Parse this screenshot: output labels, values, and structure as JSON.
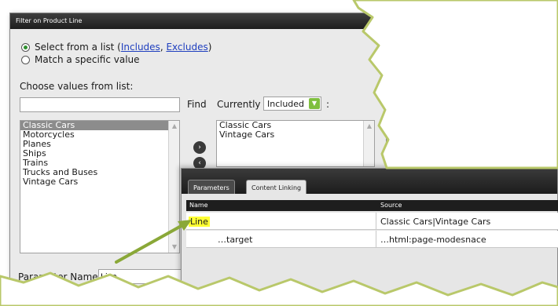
{
  "dialog": {
    "title": "Filter on Product Line",
    "radio_list_label": "Select from a list (",
    "includes_link": "Includes",
    "separator": ", ",
    "excludes_link": "Excludes",
    "closing_paren": ")",
    "radio_match_label": "Match a specific value",
    "choose_label": "Choose values from list:",
    "search_value": "",
    "find_label": "Find",
    "currently_label": "Currently",
    "currently_value": "Included",
    "colon": ":",
    "available_values": [
      "Classic Cars",
      "Motorcycles",
      "Planes",
      "Ships",
      "Trains",
      "Trucks and Buses",
      "Vintage Cars"
    ],
    "selected_index": 0,
    "chosen_values": [
      "Classic Cars",
      "Vintage Cars"
    ],
    "param_name_label": "Parameter Name:",
    "param_name_value": "Line"
  },
  "panel": {
    "tabs": [
      "Parameters",
      "Content Linking"
    ],
    "active_tab": 0,
    "columns": [
      "Name",
      "Source"
    ],
    "rows": [
      {
        "name": "Line",
        "source": "Classic Cars|Vintage Cars"
      },
      {
        "name": "…target",
        "source": "…html:page-modesnace"
      }
    ]
  },
  "icons": {
    "move_right": "chevron-right-icon",
    "move_left": "chevron-left-icon",
    "dropdown": "chevron-down-icon",
    "pointer": "arrow-annotation"
  },
  "colors": {
    "title_bg": "#2a2a2a",
    "selection": "#8c8c8c",
    "highlight": "#ffff33",
    "annotation": "#8aa838",
    "dropdown": "#7fbf3f"
  }
}
